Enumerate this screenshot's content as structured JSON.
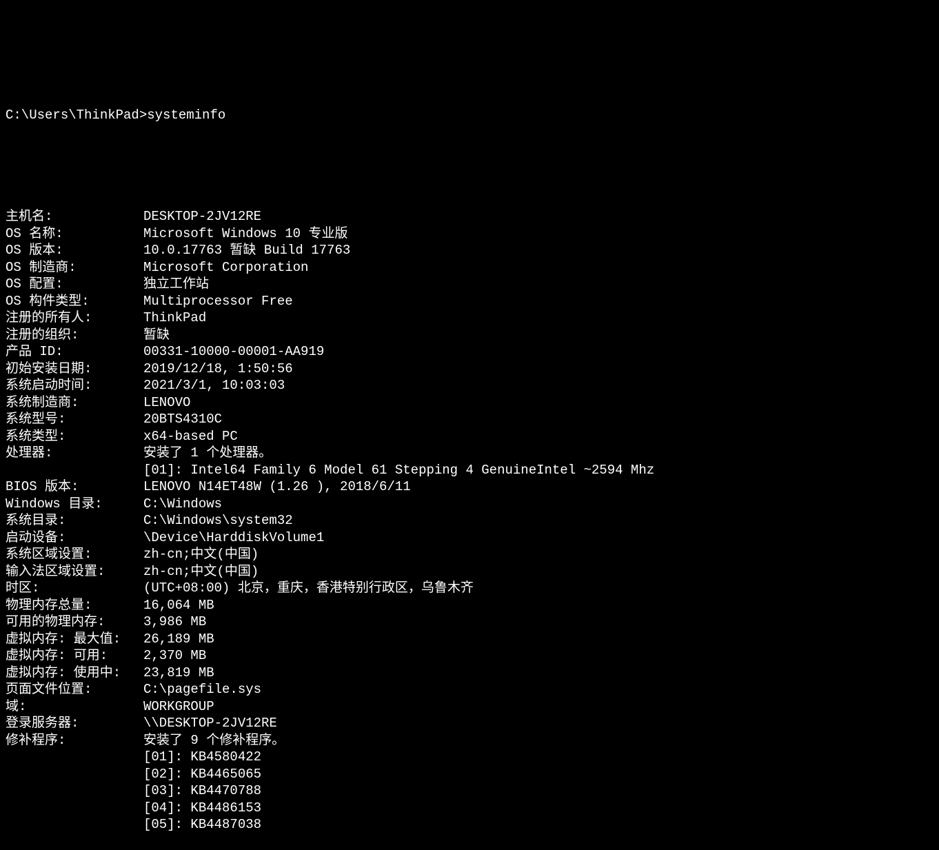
{
  "prompt": "C:\\Users\\ThinkPad>systeminfo",
  "entries": [
    {
      "label": "主机名:",
      "value": "DESKTOP-2JV12RE"
    },
    {
      "label": "OS 名称:",
      "value": "Microsoft Windows 10 专业版"
    },
    {
      "label": "OS 版本:",
      "value": "10.0.17763 暂缺 Build 17763"
    },
    {
      "label": "OS 制造商:",
      "value": "Microsoft Corporation"
    },
    {
      "label": "OS 配置:",
      "value": "独立工作站"
    },
    {
      "label": "OS 构件类型:",
      "value": "Multiprocessor Free"
    },
    {
      "label": "注册的所有人:",
      "value": "ThinkPad"
    },
    {
      "label": "注册的组织:",
      "value": "暂缺"
    },
    {
      "label": "产品 ID:",
      "value": "00331-10000-00001-AA919"
    },
    {
      "label": "初始安装日期:",
      "value": "2019/12/18, 1:50:56"
    },
    {
      "label": "系统启动时间:",
      "value": "2021/3/1, 10:03:03"
    },
    {
      "label": "系统制造商:",
      "value": "LENOVO"
    },
    {
      "label": "系统型号:",
      "value": "20BTS4310C"
    },
    {
      "label": "系统类型:",
      "value": "x64-based PC"
    },
    {
      "label": "处理器:",
      "value": "安装了 1 个处理器。"
    },
    {
      "label": "",
      "value": "[01]: Intel64 Family 6 Model 61 Stepping 4 GenuineIntel ~2594 Mhz"
    },
    {
      "label": "BIOS 版本:",
      "value": "LENOVO N14ET48W (1.26 ), 2018/6/11"
    },
    {
      "label": "Windows 目录:",
      "value": "C:\\Windows"
    },
    {
      "label": "系统目录:",
      "value": "C:\\Windows\\system32"
    },
    {
      "label": "启动设备:",
      "value": "\\Device\\HarddiskVolume1"
    },
    {
      "label": "系统区域设置:",
      "value": "zh-cn;中文(中国)"
    },
    {
      "label": "输入法区域设置:",
      "value": "zh-cn;中文(中国)"
    },
    {
      "label": "时区:",
      "value": "(UTC+08:00) 北京，重庆，香港特别行政区，乌鲁木齐"
    },
    {
      "label": "物理内存总量:",
      "value": "16,064 MB"
    },
    {
      "label": "可用的物理内存:",
      "value": "3,986 MB"
    },
    {
      "label": "虚拟内存: 最大值:",
      "value": "26,189 MB"
    },
    {
      "label": "虚拟内存: 可用:",
      "value": "2,370 MB"
    },
    {
      "label": "虚拟内存: 使用中:",
      "value": "23,819 MB"
    },
    {
      "label": "页面文件位置:",
      "value": "C:\\pagefile.sys"
    },
    {
      "label": "域:",
      "value": "WORKGROUP"
    },
    {
      "label": "登录服务器:",
      "value": "\\\\DESKTOP-2JV12RE"
    },
    {
      "label": "修补程序:",
      "value": "安装了 9 个修补程序。"
    },
    {
      "label": "",
      "value": "[01]: KB4580422"
    },
    {
      "label": "",
      "value": "[02]: KB4465065"
    },
    {
      "label": "",
      "value": "[03]: KB4470788"
    },
    {
      "label": "",
      "value": "[04]: KB4486153"
    },
    {
      "label": "",
      "value": "[05]: KB4487038"
    }
  ]
}
